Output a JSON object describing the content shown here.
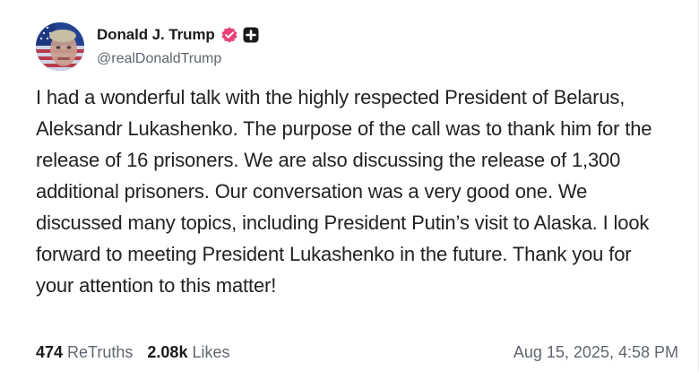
{
  "author": {
    "display_name": "Donald J. Trump",
    "handle": "@realDonaldTrump",
    "verified_icon": "verified-badge-icon",
    "plus_icon": "plus-badge-icon",
    "accent_color": "#e8417a"
  },
  "post": {
    "text": "I had a wonderful talk with the highly respected President of Belarus, Aleksandr Lukashenko. The purpose of the call was to thank him for the release of 16 prisoners. We are also discussing the release of 1,300 additional prisoners. Our conversation was a very good one. We discussed many topics, including President Putin’s visit to Alaska. I look forward to meeting President Lukashenko in the future. Thank you for your attention to this matter!"
  },
  "stats": {
    "retruths_count": "474",
    "retruths_label": "ReTruths",
    "likes_count": "2.08k",
    "likes_label": "Likes"
  },
  "timestamp": "Aug 15, 2025, 4:58 PM"
}
